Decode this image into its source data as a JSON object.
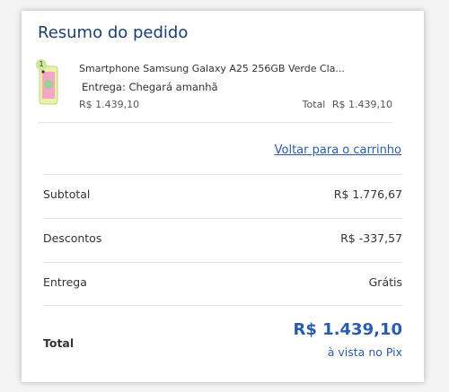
{
  "summary": {
    "title": "Resumo do pedido"
  },
  "item": {
    "quantity_badge": "1",
    "name": "Smartphone Samsung Galaxy A25 256GB Verde Cla...",
    "delivery": "Entrega: Chegará amanhã",
    "price": "R$ 1.439,10",
    "total_label": "Total",
    "total_value": "R$ 1.439,10",
    "image_icon": "phone-thumbnail"
  },
  "back_link": "Voltar para o carrinho",
  "rows": {
    "subtotal": {
      "label": "Subtotal",
      "value": "R$ 1.776,67"
    },
    "discounts": {
      "label": "Descontos",
      "value": "R$ -337,57"
    },
    "delivery": {
      "label": "Entrega",
      "value": "Grátis"
    }
  },
  "total": {
    "label": "Total",
    "value": "R$ 1.439,10",
    "note": "à vista no Pix"
  },
  "colors": {
    "title": "#1c3d6e",
    "link": "#2a5cad",
    "badge": "#c9e89a"
  }
}
